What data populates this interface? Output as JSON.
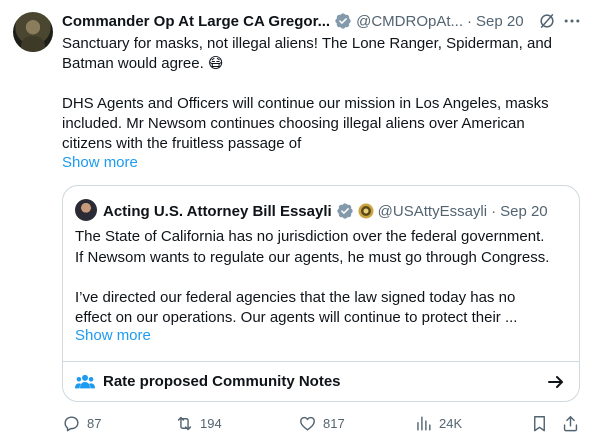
{
  "post": {
    "author_name": "Commander Op At Large CA Gregor...",
    "author_handle": "@CMDROpAt...",
    "separator": "·",
    "date": "Sep 20",
    "text_lines": [
      "Sanctuary for masks, not illegal aliens!  The Lone Ranger, Spiderman, and",
      "Batman would agree. 😷",
      "DHS Agents and Officers will continue our mission in Los Angeles, masks",
      "included.  Mr Newsom continues choosing illegal aliens over American",
      "citizens with the fruitless passage of"
    ],
    "show_more": "Show more"
  },
  "quote": {
    "author_name": "Acting U.S. Attorney Bill Essayli",
    "author_handle": "@USAttyEssayli",
    "separator": "·",
    "date": "Sep 20",
    "text_lines": [
      "The State of California has no jurisdiction over the federal government.",
      "If Newsom wants to regulate our agents, he must go through Congress.",
      "I’ve directed our federal agencies that the law signed today has no",
      "effect on our operations. Our agents will continue to protect their ..."
    ],
    "show_more": "Show more",
    "community_notes_label": "Rate proposed Community Notes"
  },
  "actions": {
    "replies": "87",
    "reposts": "194",
    "likes": "817",
    "views": "24K"
  },
  "colors": {
    "accent": "#1d9bf0",
    "secondary_text": "#536471",
    "border": "#cfd9de",
    "verified_gray": "#829aab"
  }
}
